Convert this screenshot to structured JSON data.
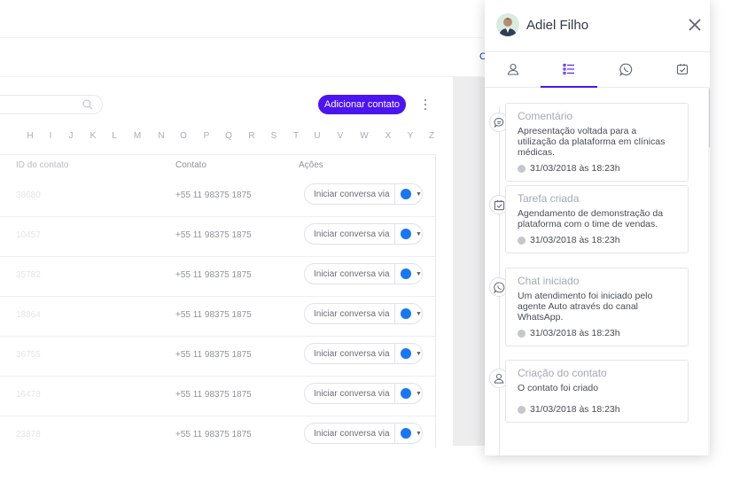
{
  "background": {
    "cut_letter": "C",
    "add_contact_label": "Adicionar contato",
    "alphabet": [
      "H",
      "I",
      "J",
      "K",
      "L",
      "M",
      "N",
      "O",
      "P",
      "Q",
      "R",
      "S",
      "T",
      "U",
      "V",
      "W",
      "X",
      "Y",
      "Z"
    ],
    "columns": {
      "id": "ID do contato",
      "contact": "Contato",
      "actions": "Ações"
    },
    "rows": [
      {
        "id": "38680",
        "phone": "+55 11 98375 1875",
        "action": "Iniciar conversa via"
      },
      {
        "id": "10457",
        "phone": "+55 11 98375 1875",
        "action": "Iniciar conversa via"
      },
      {
        "id": "35782",
        "phone": "+55 11 98375 1875",
        "action": "Iniciar conversa via"
      },
      {
        "id": "18864",
        "phone": "+55 11 98375 1875",
        "action": "Iniciar conversa via"
      },
      {
        "id": "36755",
        "phone": "+55 11 98375 1875",
        "action": "Iniciar conversa via"
      },
      {
        "id": "16478",
        "phone": "+55 11 98375 1875",
        "action": "Iniciar conversa via"
      },
      {
        "id": "23878",
        "phone": "+55 11 98375 1875",
        "action": "Iniciar conversa via"
      }
    ]
  },
  "panel": {
    "contact_name": "Adiel Filho",
    "accent_color": "#4b14f0",
    "tabs": [
      "user-icon",
      "activity-list-icon",
      "whatsapp-icon",
      "task-icon"
    ],
    "timeline": [
      {
        "icon": "comment-icon",
        "title": "Comentário",
        "description": "Apresentação voltada para a utilização da plataforma em clínicas médicas.",
        "date": "31/03/2018 às 18:23h"
      },
      {
        "icon": "task-icon",
        "title": "Tarefa criada",
        "description": "Agendamento de demonstração da plataforma com o time de vendas.",
        "date": "31/03/2018 às 18:23h"
      },
      {
        "icon": "whatsapp-icon",
        "title": "Chat iniciado",
        "description": "Um atendimento foi iniciado pelo agente Auto através do canal WhatsApp.",
        "date": "31/03/2018 às 18:23h"
      },
      {
        "icon": "user-icon",
        "title": "Criação do contato",
        "description": "O contato foi criado",
        "date": "31/03/2018 às 18:23h"
      }
    ]
  }
}
